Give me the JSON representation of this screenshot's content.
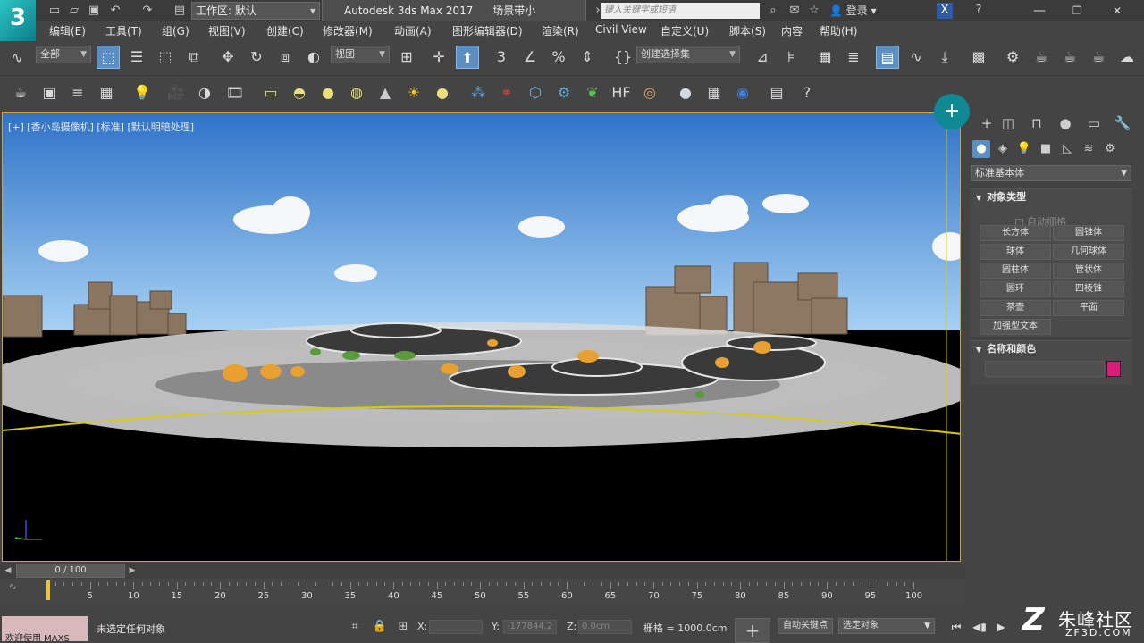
{
  "title_bar": {
    "logo_text": "3",
    "workspace_label": "工作区: 默认",
    "app_name": "Autodesk 3ds Max 2017",
    "file_name": "场景带小岛.max",
    "search_placeholder": "键入关键字或短语",
    "login_label": "登录",
    "help_label": "?"
  },
  "menu": {
    "items": [
      "编辑(E)",
      "工具(T)",
      "组(G)",
      "视图(V)",
      "创建(C)",
      "修改器(M)",
      "动画(A)",
      "图形编辑器(D)",
      "渲染(R)",
      "Civil View",
      "自定义(U)",
      "脚本(S)",
      "内容",
      "帮助(H)"
    ]
  },
  "toolbar": {
    "filter_value": "全部",
    "ref_coord_value": "视图",
    "named_sel_value": "创建选择集"
  },
  "viewport": {
    "label": "[+] [香小岛摄像机] [标准] [默认明暗处理]",
    "sky_color": "#4f92d8",
    "ground_color": "#000000",
    "border_color": "#c9a83a"
  },
  "command_panel": {
    "category_value": "标准基本体",
    "object_type_title": "对象类型",
    "autogrid_label": "自动栅格",
    "object_buttons": [
      "长方体",
      "圆锥体",
      "球体",
      "几何球体",
      "圆柱体",
      "管状体",
      "圆环",
      "四棱锥",
      "茶壶",
      "平面",
      "加强型文本"
    ],
    "name_color_title": "名称和颜色",
    "object_color": "#e0197d",
    "accent_color": "#0f8a94"
  },
  "timeline": {
    "frame_label": "0 / 100",
    "ticks": [
      "5",
      "10",
      "15",
      "20",
      "25",
      "30",
      "35",
      "40",
      "45",
      "50",
      "55",
      "60",
      "65",
      "70",
      "75",
      "80",
      "85",
      "90",
      "95",
      "100"
    ]
  },
  "status": {
    "maxscript_text": "欢迎使用 MAXS",
    "status_text": "未选定任何对象",
    "x_label": "X:",
    "y_label": "Y:",
    "y_value": "-177844.2",
    "z_label": "Z:",
    "z_value": "0.0cm",
    "grid_text": "栅格 = 1000.0cm",
    "autokey_label": "自动关键点",
    "selected_dropdown": "选定对象"
  },
  "watermark": {
    "logo": "Z",
    "text": "朱峰社区",
    "sub": "ZF3D.COM"
  }
}
